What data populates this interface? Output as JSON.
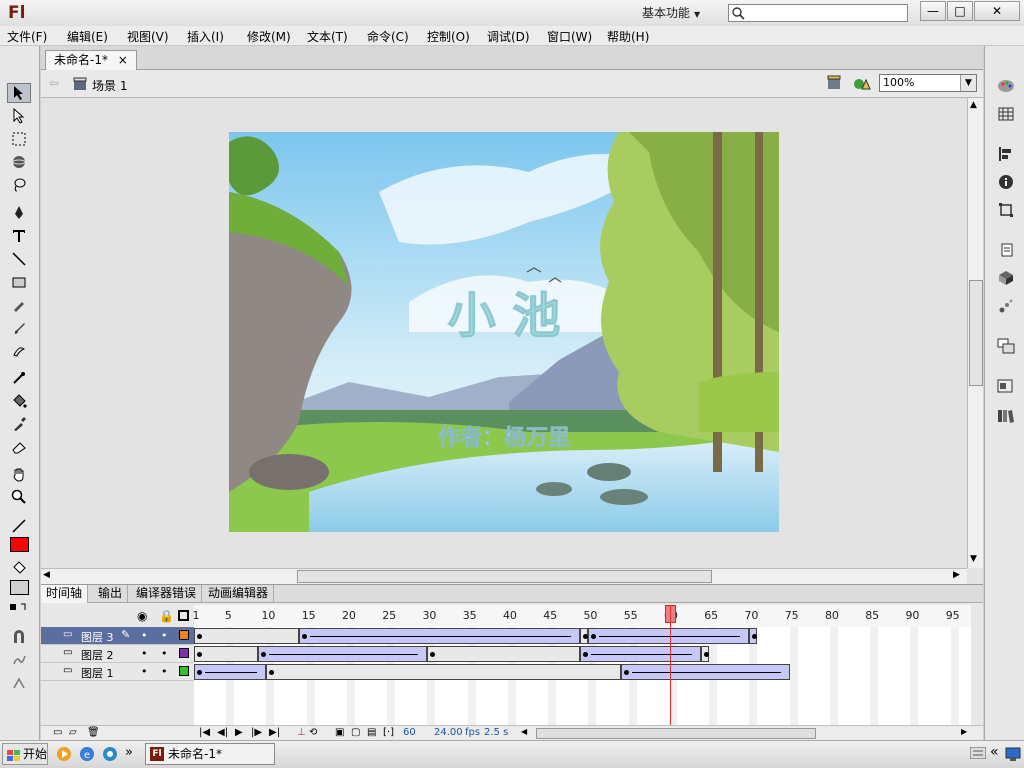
{
  "app": {
    "logo": "Fl",
    "workspace": "基本功能",
    "window_buttons": [
      "—",
      "□",
      "✕"
    ]
  },
  "menu": [
    "文件(F)",
    "编辑(E)",
    "视图(V)",
    "插入(I)",
    "修改(M)",
    "文本(T)",
    "命令(C)",
    "控制(O)",
    "调试(D)",
    "窗口(W)",
    "帮助(H)"
  ],
  "document": {
    "tab_title": "未命名-1*",
    "tab_close": "×",
    "scene": "场景 1",
    "zoom": "100%"
  },
  "stage": {
    "title": "小 池",
    "author": "作者：杨万里",
    "colors": {
      "sky": "#8fd0f0",
      "title_color": "#a6dee0",
      "author_color": "#b6e4e6",
      "grass": "#8cc84c",
      "river": "#b8ddf0"
    }
  },
  "timeline": {
    "tabs": [
      "时间轴",
      "输出",
      "编译器错误",
      "动画编辑器"
    ],
    "frame_numbers": [
      1,
      5,
      10,
      15,
      20,
      25,
      30,
      35,
      40,
      45,
      50,
      55,
      60,
      65,
      70,
      75,
      80,
      85,
      90,
      95
    ],
    "current_frame": 60,
    "layers": [
      {
        "name": "图层 3",
        "color": "#f08020",
        "selected": true
      },
      {
        "name": "图层 2",
        "color": "#8030b0",
        "selected": false
      },
      {
        "name": "图层 1",
        "color": "#30c030",
        "selected": false
      }
    ],
    "status": {
      "frame": "60",
      "fps": "24.00",
      "fps_unit": "fps",
      "time": "2.5 s"
    }
  },
  "taskbar": {
    "start": "开始",
    "item": "未命名-1*",
    "chevron": "»"
  },
  "tool_color": "#ff0000"
}
